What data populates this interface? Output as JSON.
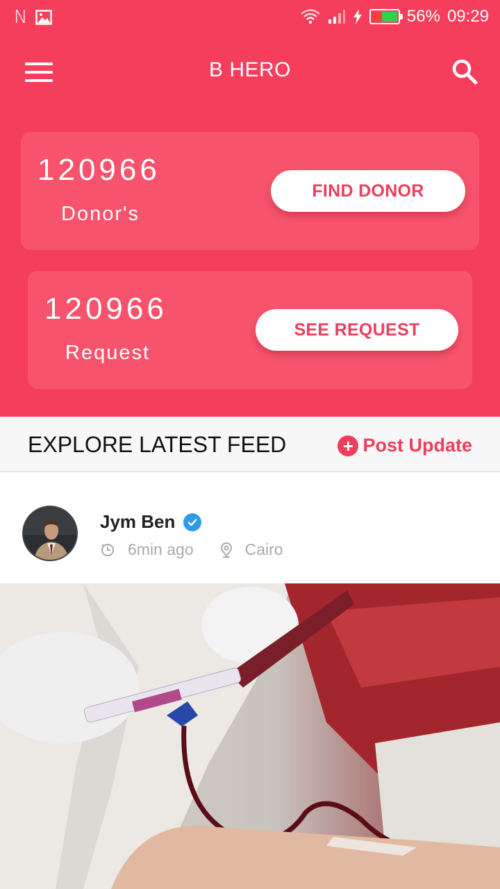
{
  "status_bar": {
    "battery_percent": "56%",
    "time": "09:29",
    "left_icons": [
      "n-icon",
      "image-icon"
    ],
    "right_icons": [
      "wifi-icon",
      "signal-icon",
      "charging-icon",
      "battery-icon"
    ]
  },
  "app_bar": {
    "title": "B HERO",
    "menu_icon": "hamburger-icon",
    "search_icon": "search-icon"
  },
  "stats": {
    "donors": {
      "count": "120966",
      "label": "Donor's",
      "button": "FIND DONOR"
    },
    "requests": {
      "count": "120966",
      "label": "Request",
      "button": "SEE REQUEST"
    }
  },
  "feed": {
    "title": "EXPLORE LATEST FEED",
    "post_update_label": "Post Update"
  },
  "post": {
    "author": "Jym Ben",
    "verified": true,
    "time_ago": "6min ago",
    "location": "Cairo"
  },
  "colors": {
    "primary": "#f53d5c",
    "card": "#f7536c",
    "accent_text": "#ee3d5d",
    "verified": "#2f9be8"
  }
}
